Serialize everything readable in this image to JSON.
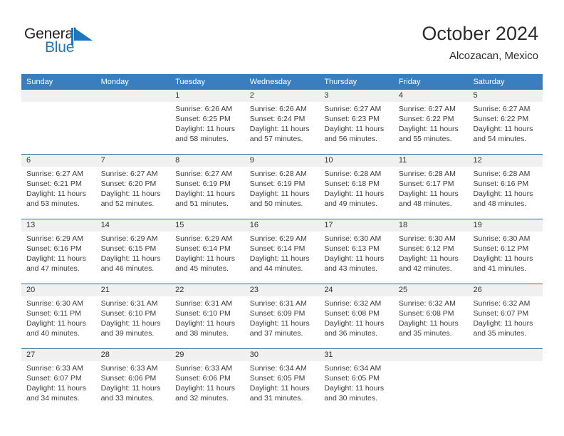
{
  "brand": {
    "name_part1": "General",
    "name_part2": "Blue",
    "flag_icon": "blue-triangle-flag-icon",
    "accent_color": "#1e76bd"
  },
  "header": {
    "title": "October 2024",
    "subtitle": "Alcozacan, Mexico"
  },
  "theme": {
    "header_blue": "#3b7ebd",
    "rule_blue": "#2e6da4",
    "band_gray": "#f0f0f0"
  },
  "weekday_headers": [
    "Sunday",
    "Monday",
    "Tuesday",
    "Wednesday",
    "Thursday",
    "Friday",
    "Saturday"
  ],
  "weeks": [
    [
      {
        "day": "",
        "lines": []
      },
      {
        "day": "",
        "lines": []
      },
      {
        "day": "1",
        "lines": [
          "Sunrise: 6:26 AM",
          "Sunset: 6:25 PM",
          "Daylight: 11 hours",
          "and 58 minutes."
        ]
      },
      {
        "day": "2",
        "lines": [
          "Sunrise: 6:26 AM",
          "Sunset: 6:24 PM",
          "Daylight: 11 hours",
          "and 57 minutes."
        ]
      },
      {
        "day": "3",
        "lines": [
          "Sunrise: 6:27 AM",
          "Sunset: 6:23 PM",
          "Daylight: 11 hours",
          "and 56 minutes."
        ]
      },
      {
        "day": "4",
        "lines": [
          "Sunrise: 6:27 AM",
          "Sunset: 6:22 PM",
          "Daylight: 11 hours",
          "and 55 minutes."
        ]
      },
      {
        "day": "5",
        "lines": [
          "Sunrise: 6:27 AM",
          "Sunset: 6:22 PM",
          "Daylight: 11 hours",
          "and 54 minutes."
        ]
      }
    ],
    [
      {
        "day": "6",
        "lines": [
          "Sunrise: 6:27 AM",
          "Sunset: 6:21 PM",
          "Daylight: 11 hours",
          "and 53 minutes."
        ]
      },
      {
        "day": "7",
        "lines": [
          "Sunrise: 6:27 AM",
          "Sunset: 6:20 PM",
          "Daylight: 11 hours",
          "and 52 minutes."
        ]
      },
      {
        "day": "8",
        "lines": [
          "Sunrise: 6:27 AM",
          "Sunset: 6:19 PM",
          "Daylight: 11 hours",
          "and 51 minutes."
        ]
      },
      {
        "day": "9",
        "lines": [
          "Sunrise: 6:28 AM",
          "Sunset: 6:19 PM",
          "Daylight: 11 hours",
          "and 50 minutes."
        ]
      },
      {
        "day": "10",
        "lines": [
          "Sunrise: 6:28 AM",
          "Sunset: 6:18 PM",
          "Daylight: 11 hours",
          "and 49 minutes."
        ]
      },
      {
        "day": "11",
        "lines": [
          "Sunrise: 6:28 AM",
          "Sunset: 6:17 PM",
          "Daylight: 11 hours",
          "and 48 minutes."
        ]
      },
      {
        "day": "12",
        "lines": [
          "Sunrise: 6:28 AM",
          "Sunset: 6:16 PM",
          "Daylight: 11 hours",
          "and 48 minutes."
        ]
      }
    ],
    [
      {
        "day": "13",
        "lines": [
          "Sunrise: 6:29 AM",
          "Sunset: 6:16 PM",
          "Daylight: 11 hours",
          "and 47 minutes."
        ]
      },
      {
        "day": "14",
        "lines": [
          "Sunrise: 6:29 AM",
          "Sunset: 6:15 PM",
          "Daylight: 11 hours",
          "and 46 minutes."
        ]
      },
      {
        "day": "15",
        "lines": [
          "Sunrise: 6:29 AM",
          "Sunset: 6:14 PM",
          "Daylight: 11 hours",
          "and 45 minutes."
        ]
      },
      {
        "day": "16",
        "lines": [
          "Sunrise: 6:29 AM",
          "Sunset: 6:14 PM",
          "Daylight: 11 hours",
          "and 44 minutes."
        ]
      },
      {
        "day": "17",
        "lines": [
          "Sunrise: 6:30 AM",
          "Sunset: 6:13 PM",
          "Daylight: 11 hours",
          "and 43 minutes."
        ]
      },
      {
        "day": "18",
        "lines": [
          "Sunrise: 6:30 AM",
          "Sunset: 6:12 PM",
          "Daylight: 11 hours",
          "and 42 minutes."
        ]
      },
      {
        "day": "19",
        "lines": [
          "Sunrise: 6:30 AM",
          "Sunset: 6:12 PM",
          "Daylight: 11 hours",
          "and 41 minutes."
        ]
      }
    ],
    [
      {
        "day": "20",
        "lines": [
          "Sunrise: 6:30 AM",
          "Sunset: 6:11 PM",
          "Daylight: 11 hours",
          "and 40 minutes."
        ]
      },
      {
        "day": "21",
        "lines": [
          "Sunrise: 6:31 AM",
          "Sunset: 6:10 PM",
          "Daylight: 11 hours",
          "and 39 minutes."
        ]
      },
      {
        "day": "22",
        "lines": [
          "Sunrise: 6:31 AM",
          "Sunset: 6:10 PM",
          "Daylight: 11 hours",
          "and 38 minutes."
        ]
      },
      {
        "day": "23",
        "lines": [
          "Sunrise: 6:31 AM",
          "Sunset: 6:09 PM",
          "Daylight: 11 hours",
          "and 37 minutes."
        ]
      },
      {
        "day": "24",
        "lines": [
          "Sunrise: 6:32 AM",
          "Sunset: 6:08 PM",
          "Daylight: 11 hours",
          "and 36 minutes."
        ]
      },
      {
        "day": "25",
        "lines": [
          "Sunrise: 6:32 AM",
          "Sunset: 6:08 PM",
          "Daylight: 11 hours",
          "and 35 minutes."
        ]
      },
      {
        "day": "26",
        "lines": [
          "Sunrise: 6:32 AM",
          "Sunset: 6:07 PM",
          "Daylight: 11 hours",
          "and 35 minutes."
        ]
      }
    ],
    [
      {
        "day": "27",
        "lines": [
          "Sunrise: 6:33 AM",
          "Sunset: 6:07 PM",
          "Daylight: 11 hours",
          "and 34 minutes."
        ]
      },
      {
        "day": "28",
        "lines": [
          "Sunrise: 6:33 AM",
          "Sunset: 6:06 PM",
          "Daylight: 11 hours",
          "and 33 minutes."
        ]
      },
      {
        "day": "29",
        "lines": [
          "Sunrise: 6:33 AM",
          "Sunset: 6:06 PM",
          "Daylight: 11 hours",
          "and 32 minutes."
        ]
      },
      {
        "day": "30",
        "lines": [
          "Sunrise: 6:34 AM",
          "Sunset: 6:05 PM",
          "Daylight: 11 hours",
          "and 31 minutes."
        ]
      },
      {
        "day": "31",
        "lines": [
          "Sunrise: 6:34 AM",
          "Sunset: 6:05 PM",
          "Daylight: 11 hours",
          "and 30 minutes."
        ]
      },
      {
        "day": "",
        "lines": []
      },
      {
        "day": "",
        "lines": []
      }
    ]
  ]
}
